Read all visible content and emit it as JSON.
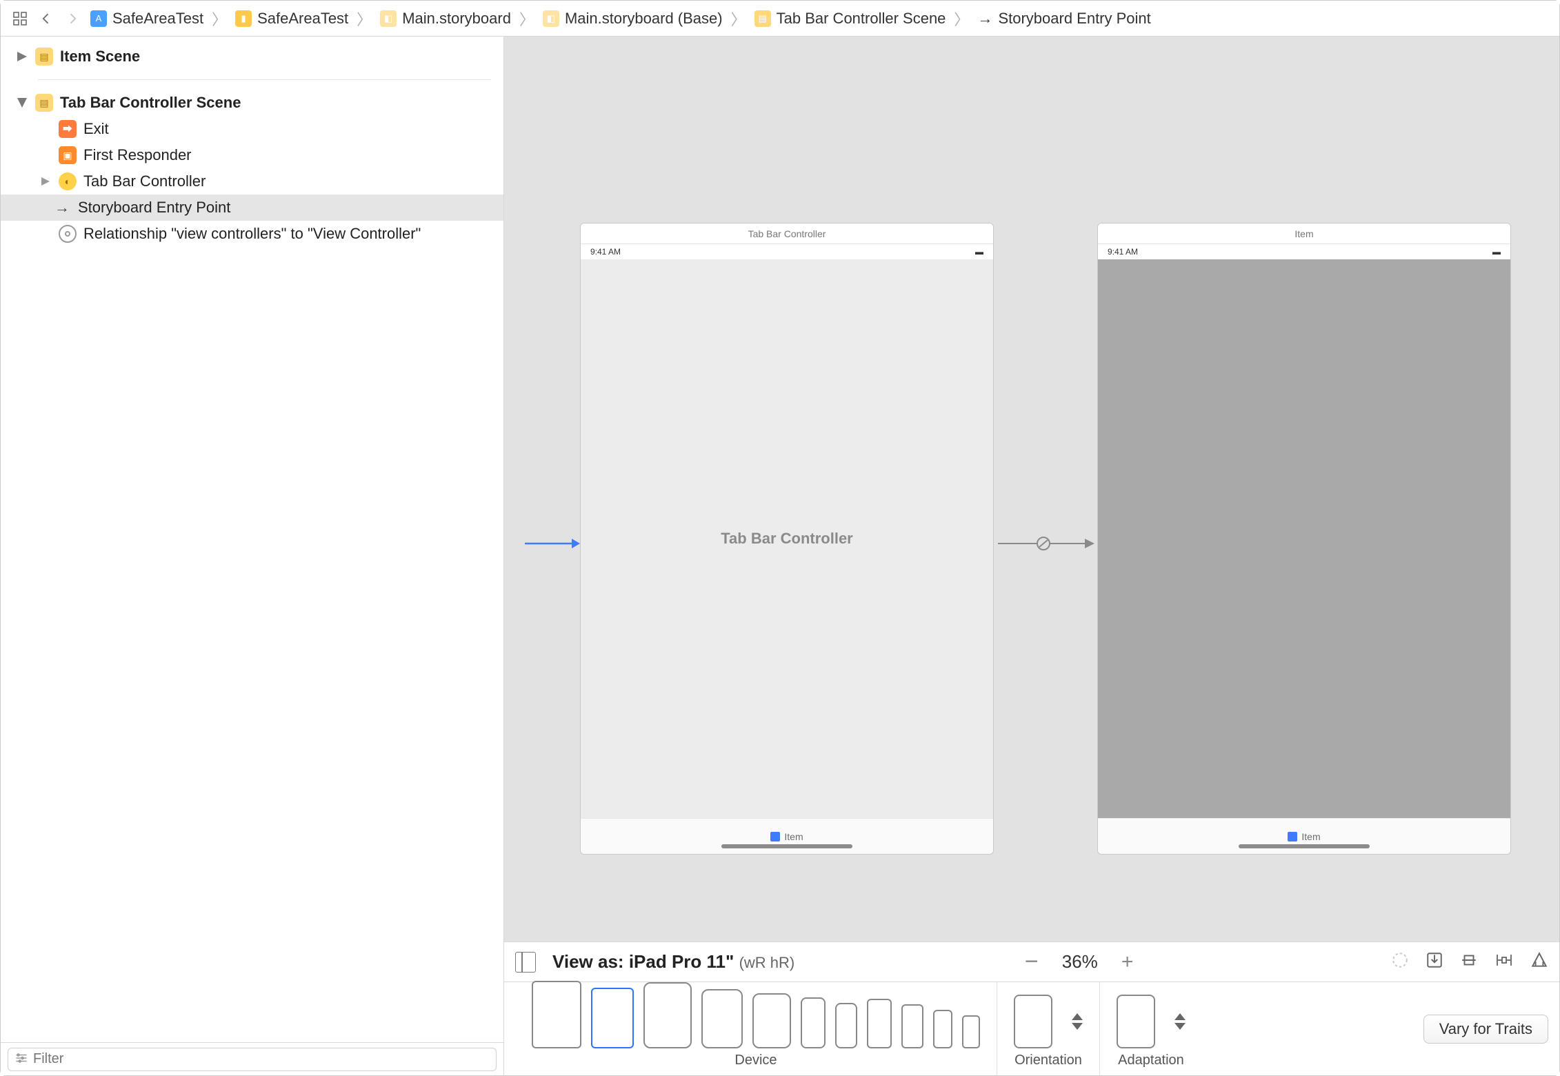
{
  "breadcrumbs": {
    "items": [
      {
        "label": "SafeAreaTest",
        "icon": "proj"
      },
      {
        "label": "SafeAreaTest",
        "icon": "folder"
      },
      {
        "label": "Main.storyboard",
        "icon": "story"
      },
      {
        "label": "Main.storyboard (Base)",
        "icon": "story"
      },
      {
        "label": "Tab Bar Controller Scene",
        "icon": "scene"
      },
      {
        "label": "Storyboard Entry Point",
        "icon": "arrow"
      }
    ]
  },
  "outline": {
    "scenes": [
      {
        "label": "Item Scene"
      },
      {
        "label": "Tab Bar Controller Scene"
      }
    ],
    "children": [
      {
        "label": "Exit"
      },
      {
        "label": "First Responder"
      },
      {
        "label": "Tab Bar Controller"
      },
      {
        "label": "Storyboard Entry Point"
      },
      {
        "label": "Relationship \"view controllers\" to \"View Controller\""
      }
    ],
    "filter_placeholder": "Filter"
  },
  "canvas": {
    "scene_a": {
      "title": "Tab Bar Controller",
      "time": "9:41 AM",
      "body_label": "Tab Bar Controller",
      "tab_label": "Item"
    },
    "scene_b": {
      "title": "Item",
      "time": "9:41 AM",
      "tab_label": "Item"
    }
  },
  "trait": {
    "view_as_prefix": "View as: ",
    "view_as_device": "iPad Pro 11\"",
    "size_class": "(wR hR)",
    "zoom": "36%"
  },
  "devbar": {
    "device_label": "Device",
    "orientation_label": "Orientation",
    "adaptation_label": "Adaptation",
    "vary_label": "Vary for Traits"
  }
}
